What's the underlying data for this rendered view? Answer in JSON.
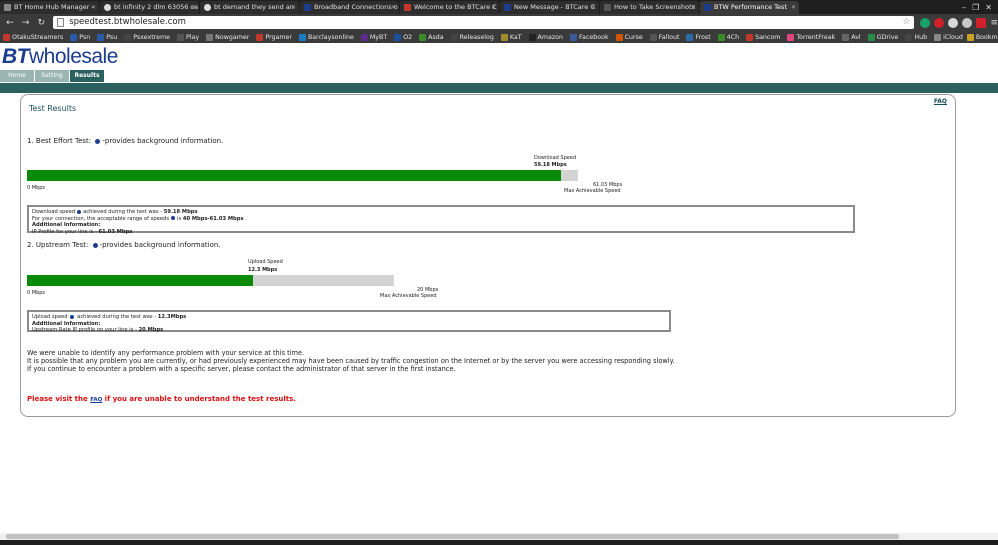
{
  "browser": {
    "tabs": [
      {
        "label": "BT Home Hub Manager -"
      },
      {
        "label": "bt infinity 2 dlm 63056 ca"
      },
      {
        "label": "bt demand they send an"
      },
      {
        "label": "Broadband Connections o"
      },
      {
        "label": "Welcome to the BTCare C"
      },
      {
        "label": "New Message - BTCare C"
      },
      {
        "label": "How to Take Screenshots"
      },
      {
        "label": "BTW Performance Test",
        "active": true
      }
    ],
    "url": "speedtest.btwholesale.com",
    "bookmarks": [
      {
        "label": "OtakuStreamers",
        "color": "#c0392b"
      },
      {
        "label": "Psn",
        "color": "#2b5aa8"
      },
      {
        "label": "Psu",
        "color": "#2b5aa8"
      },
      {
        "label": "Psxextreme",
        "color": "#444"
      },
      {
        "label": "Play",
        "color": "#555"
      },
      {
        "label": "Nowgamer",
        "color": "#777"
      },
      {
        "label": "Prgamer",
        "color": "#c0392b"
      },
      {
        "label": "Barclaysonline",
        "color": "#1a7bc4"
      },
      {
        "label": "MyBT",
        "color": "#5a2b8a"
      },
      {
        "label": "O2",
        "color": "#1a4f9a"
      },
      {
        "label": "Asda",
        "color": "#3a8a2a"
      },
      {
        "label": "Releaselog",
        "color": "#444"
      },
      {
        "label": "KaT",
        "color": "#a08a2a"
      },
      {
        "label": "Amazon",
        "color": "#222"
      },
      {
        "label": "Facebook",
        "color": "#3b5998"
      },
      {
        "label": "Curse",
        "color": "#d35400"
      },
      {
        "label": "Fallout",
        "color": "#555"
      },
      {
        "label": "Frost",
        "color": "#2a6aa8"
      },
      {
        "label": "4Ch",
        "color": "#3a8a2a"
      },
      {
        "label": "Sancom",
        "color": "#c0392b"
      },
      {
        "label": "TorrentFreak",
        "color": "#e0457b"
      },
      {
        "label": "Avl",
        "color": "#666"
      },
      {
        "label": "GDrive",
        "color": "#2a8a4a"
      },
      {
        "label": "Hub",
        "color": "#444"
      },
      {
        "label": "iCloud",
        "color": "#888"
      }
    ],
    "bookmarks_folder": "Bookmarks"
  },
  "site": {
    "logo_bt": "BT",
    "logo_wholesale": "wholesale",
    "nav_tabs": [
      {
        "label": "Home"
      },
      {
        "label": "Setting"
      },
      {
        "label": "Results",
        "active": true
      }
    ]
  },
  "results": {
    "title": "Test Results",
    "faq": "FAQ",
    "best_effort": {
      "heading": "1. Best Effort Test:",
      "suffix": "-provides background information.",
      "speed_label": "Download Speed",
      "speed_value": "59.18 Mbps",
      "min_label": "0 Mbps",
      "max_value": "61.03 Mbps",
      "max_label": "Max Achievable Speed",
      "fill_fraction": 0.9697,
      "info": {
        "line1_a": "Download speed",
        "line1_b": "achieved during the test was - ",
        "line1_value": "59.18 Mbps",
        "line2_a": "For your connection, the acceptable range of speeds",
        "line2_b": "is ",
        "line2_value": "40 Mbps-61.03 Mbps",
        "line2_end": " .",
        "line3": "Additional Information:",
        "line4_a": "IP Profile for your line is - ",
        "line4_value": "61.03 Mbps"
      }
    },
    "upstream": {
      "heading": "2. Upstream Test:",
      "suffix": "-provides background information.",
      "speed_label": "Upload Speed",
      "speed_value": "12.3 Mbps",
      "min_label": "0 Mbps",
      "max_value": "20 Mbps",
      "max_label": "Max Achievable Speed",
      "fill_fraction": 0.615,
      "info": {
        "line1_a": "Upload speed",
        "line1_b": " achieved during the test was - ",
        "line1_value": "12.3Mbps",
        "line2": "Additional Information:",
        "line3_a": " Upstream Rate IP profile on your line is - ",
        "line3_value": "20 Mbps"
      }
    },
    "message": [
      "We were unable to identify any performance problem with your service at this time.",
      "It is possible that any problem you are currently, or had previously experienced may have been caused by traffic congestion on the Internet or by the server you were accessing responding slowly.",
      "If you continue to encounter a problem with a specific server, please contact the administrator of that server in the first instance."
    ],
    "visit_a": "Please visit the ",
    "visit_link": "FAQ",
    "visit_b": " if you are unable to understand the test results."
  }
}
